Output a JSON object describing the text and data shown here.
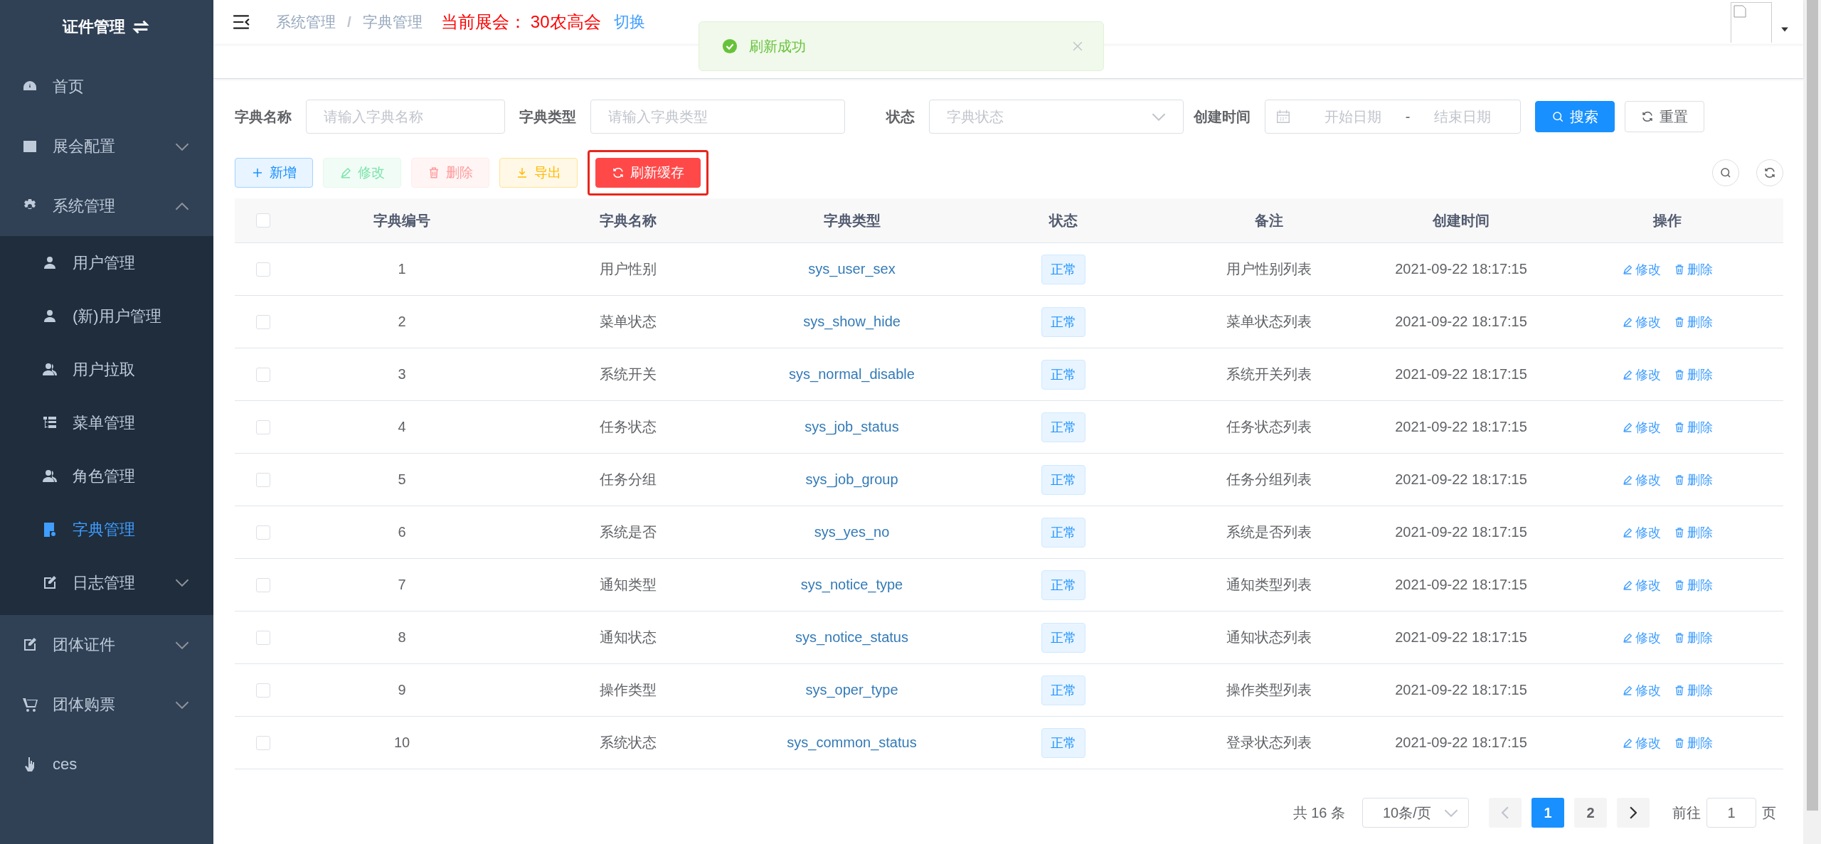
{
  "sidebar": {
    "title": "证件管理",
    "items": [
      {
        "label": "首页",
        "kind": "link"
      },
      {
        "label": "展会配置",
        "kind": "menu",
        "expanded": false
      },
      {
        "label": "系统管理",
        "kind": "menu",
        "expanded": true,
        "children": [
          {
            "label": "用户管理",
            "kind": "link",
            "selected": false
          },
          {
            "label": "(新)用户管理",
            "kind": "link",
            "selected": false
          },
          {
            "label": "用户拉取",
            "kind": "link",
            "selected": false
          },
          {
            "label": "菜单管理",
            "kind": "link",
            "selected": false
          },
          {
            "label": "角色管理",
            "kind": "link",
            "selected": false
          },
          {
            "label": "字典管理",
            "kind": "link",
            "selected": true
          },
          {
            "label": "日志管理",
            "kind": "menu",
            "expanded": false,
            "selected": false
          }
        ]
      },
      {
        "label": "团体证件",
        "kind": "menu",
        "expanded": false
      },
      {
        "label": "团体购票",
        "kind": "menu",
        "expanded": false
      },
      {
        "label": "ces",
        "kind": "link"
      }
    ]
  },
  "header": {
    "breadcrumb": [
      "系统管理",
      "字典管理"
    ],
    "separator": "/",
    "expo_label": "当前展会：",
    "expo_name": "30农高会",
    "switch": "切换"
  },
  "toast": {
    "message": "刷新成功"
  },
  "filters": [
    {
      "label": "字典名称",
      "kind": "text",
      "placeholder": "请输入字典名称"
    },
    {
      "label": "字典类型",
      "kind": "text",
      "placeholder": "请输入字典类型"
    },
    {
      "label": "状态",
      "kind": "select",
      "placeholder": "字典状态"
    },
    {
      "label": "创建时间",
      "kind": "daterange",
      "start_placeholder": "开始日期",
      "separator": "-",
      "end_placeholder": "结束日期"
    }
  ],
  "filter_buttons": [
    {
      "label": "搜索",
      "kind": "primary"
    },
    {
      "label": "重置",
      "kind": "default"
    }
  ],
  "toolbar": [
    {
      "label": "新增",
      "kind": "add",
      "disabled": false,
      "highlighted": false
    },
    {
      "label": "修改",
      "kind": "edit",
      "disabled": true,
      "highlighted": false
    },
    {
      "label": "删除",
      "kind": "delete",
      "disabled": true,
      "highlighted": false
    },
    {
      "label": "导出",
      "kind": "export",
      "disabled": false,
      "highlighted": false
    },
    {
      "label": "刷新缓存",
      "kind": "refresh",
      "disabled": false,
      "highlighted": true
    }
  ],
  "table": {
    "header_checked": false,
    "columns": [
      "字典编号",
      "字典名称",
      "字典类型",
      "状态",
      "备注",
      "创建时间",
      "操作"
    ],
    "rows": [
      {
        "checked": false,
        "id": "1",
        "name": "用户性别",
        "type": "sys_user_sex",
        "status": "正常",
        "remark": "用户性别列表",
        "created": "2021-09-22 18:17:15",
        "edit": "修改",
        "delete": "删除"
      },
      {
        "checked": false,
        "id": "2",
        "name": "菜单状态",
        "type": "sys_show_hide",
        "status": "正常",
        "remark": "菜单状态列表",
        "created": "2021-09-22 18:17:15",
        "edit": "修改",
        "delete": "删除"
      },
      {
        "checked": false,
        "id": "3",
        "name": "系统开关",
        "type": "sys_normal_disable",
        "status": "正常",
        "remark": "系统开关列表",
        "created": "2021-09-22 18:17:15",
        "edit": "修改",
        "delete": "删除"
      },
      {
        "checked": false,
        "id": "4",
        "name": "任务状态",
        "type": "sys_job_status",
        "status": "正常",
        "remark": "任务状态列表",
        "created": "2021-09-22 18:17:15",
        "edit": "修改",
        "delete": "删除"
      },
      {
        "checked": false,
        "id": "5",
        "name": "任务分组",
        "type": "sys_job_group",
        "status": "正常",
        "remark": "任务分组列表",
        "created": "2021-09-22 18:17:15",
        "edit": "修改",
        "delete": "删除"
      },
      {
        "checked": false,
        "id": "6",
        "name": "系统是否",
        "type": "sys_yes_no",
        "status": "正常",
        "remark": "系统是否列表",
        "created": "2021-09-22 18:17:15",
        "edit": "修改",
        "delete": "删除"
      },
      {
        "checked": false,
        "id": "7",
        "name": "通知类型",
        "type": "sys_notice_type",
        "status": "正常",
        "remark": "通知类型列表",
        "created": "2021-09-22 18:17:15",
        "edit": "修改",
        "delete": "删除"
      },
      {
        "checked": false,
        "id": "8",
        "name": "通知状态",
        "type": "sys_notice_status",
        "status": "正常",
        "remark": "通知状态列表",
        "created": "2021-09-22 18:17:15",
        "edit": "修改",
        "delete": "删除"
      },
      {
        "checked": false,
        "id": "9",
        "name": "操作类型",
        "type": "sys_oper_type",
        "status": "正常",
        "remark": "操作类型列表",
        "created": "2021-09-22 18:17:15",
        "edit": "修改",
        "delete": "删除"
      },
      {
        "checked": false,
        "id": "10",
        "name": "系统状态",
        "type": "sys_common_status",
        "status": "正常",
        "remark": "登录状态列表",
        "created": "2021-09-22 18:17:15",
        "edit": "修改",
        "delete": "删除"
      }
    ]
  },
  "pagination": {
    "total": "共 16 条",
    "page_size": "10条/页",
    "pages": [
      {
        "label": "1",
        "selected": true
      },
      {
        "label": "2",
        "selected": false
      }
    ],
    "goto_label": "前往",
    "goto_value": "1",
    "page_suffix": "页"
  }
}
